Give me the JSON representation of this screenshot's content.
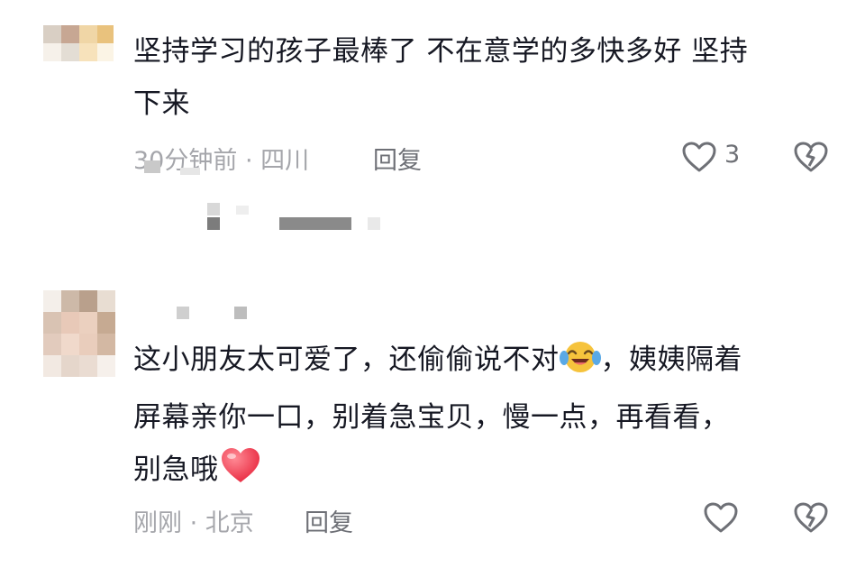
{
  "comments": [
    {
      "text_line1": "坚持学习的孩子最棒了 不在意学的多快多好 坚持",
      "text_line2": "下来",
      "meta": "30分钟前 · 四川",
      "reply_label": "回复",
      "like_count": "3"
    },
    {
      "text_line1": "这小朋友太可爱了，还偷偷说不对",
      "text_line1_after": "，姨姨隔着",
      "text_line2": "屏幕亲你一口，别着急宝贝，慢一点，再看看，",
      "text_line3": "别急哦",
      "meta": "刚刚 · 北京",
      "reply_label": "回复"
    }
  ],
  "colors": {
    "text": "#161823",
    "meta": "#a5a6ab",
    "reply": "#6e7076",
    "heart_emoji": "#f0455a",
    "laugh_emoji": "#f6c33c"
  }
}
